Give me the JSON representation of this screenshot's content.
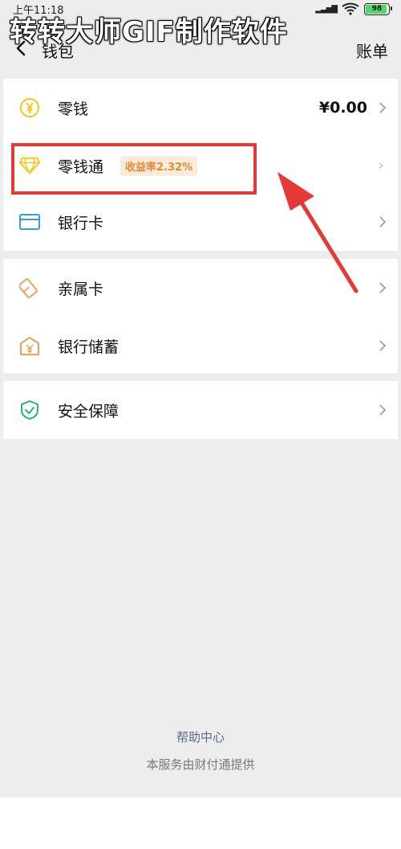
{
  "status_bar": {
    "time": "上午11:18",
    "battery": "98"
  },
  "watermark": "转转大师GIF制作软件",
  "header": {
    "title": "钱包",
    "action": "账单"
  },
  "wallet_items": [
    {
      "label": "零钱",
      "value": "¥0.00",
      "icon": "yuan-coin-icon"
    },
    {
      "label": "零钱通",
      "badge": "收益率2.32%",
      "icon": "diamond-icon"
    },
    {
      "label": "银行卡",
      "icon": "bank-card-icon"
    }
  ],
  "family_items": [
    {
      "label": "亲属卡",
      "icon": "family-card-icon"
    },
    {
      "label": "银行储蓄",
      "icon": "bank-deposit-icon"
    }
  ],
  "security_items": [
    {
      "label": "安全保障",
      "icon": "shield-check-icon"
    }
  ],
  "footer": {
    "help_link": "帮助中心",
    "provider_note": "本服务由财付通提供"
  },
  "colors": {
    "accent_yellow": "#f5c518",
    "badge_text": "#e68a37",
    "badge_bg": "#fcebd8",
    "annotation_red": "#e53935",
    "card_blue": "#3a9bd9",
    "family_orange": "#e8a35a",
    "shield_green": "#2bb673"
  }
}
